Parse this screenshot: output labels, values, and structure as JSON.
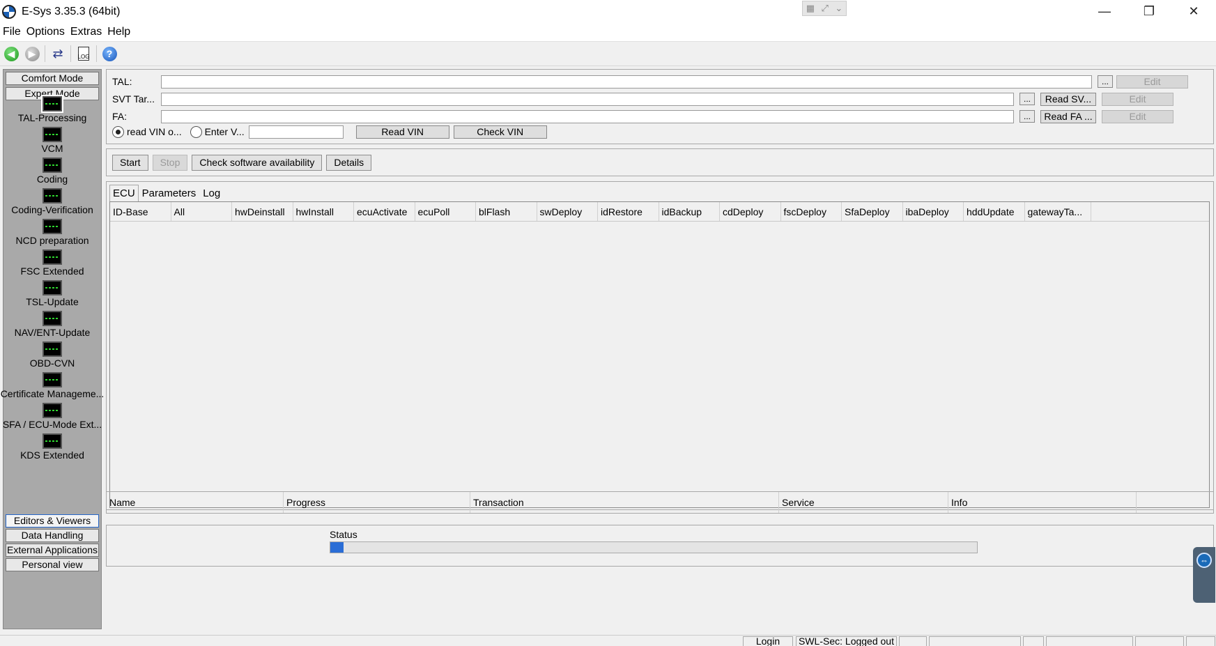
{
  "window": {
    "title": "E-Sys 3.35.3  (64bit)",
    "minimize_glyph": "—",
    "maximize_glyph": "❐",
    "close_glyph": "✕",
    "snap_icons": [
      "grid-icon",
      "expand-icon",
      "chevron-down-icon"
    ]
  },
  "menu": [
    "File",
    "Options",
    "Extras",
    "Help"
  ],
  "toolbar": {
    "icons": [
      "back-icon",
      "forward-icon",
      "network-icon",
      "document-icon",
      "help-icon"
    ]
  },
  "sidebar": {
    "mode_buttons": [
      "Comfort Mode",
      "Expert Mode"
    ],
    "items": [
      "TAL-Processing",
      "VCM",
      "Coding",
      "Coding-Verification",
      "NCD preparation",
      "FSC Extended",
      "TSL-Update",
      "NAV/ENT-Update",
      "OBD-CVN",
      "Certificate Manageme...",
      "SFA / ECU-Mode Ext...",
      "KDS Extended"
    ],
    "bottom_buttons": [
      "Editors & Viewers",
      "Data Handling",
      "External Applications",
      "Personal view"
    ]
  },
  "top_panel": {
    "tal_label": "TAL:",
    "svt_label": "SVT Tar...",
    "fa_label": "FA:",
    "dots": "...",
    "edit_label": "Edit",
    "read_svt_label": "Read SV...",
    "read_fa_label": "Read FA ...",
    "radio_read_vin": "read VIN o...",
    "radio_enter_vin": "Enter V...",
    "read_vin_button": "Read VIN",
    "check_vin_button": "Check VIN"
  },
  "actions": {
    "start": "Start",
    "stop": "Stop",
    "check_sw": "Check software availability",
    "details": "Details"
  },
  "tabs": [
    "ECU",
    "Parameters",
    "Log"
  ],
  "ecu_table": {
    "columns": [
      "ID-Base",
      "All",
      "hwDeinstall",
      "hwInstall",
      "ecuActivate",
      "ecuPoll",
      "blFlash",
      "swDeploy",
      "idRestore",
      "idBackup",
      "cdDeploy",
      "fscDeploy",
      "SfaDeploy",
      "ibaDeploy",
      "hddUpdate",
      "gatewayTa..."
    ]
  },
  "transaction_table": {
    "columns": [
      "Name",
      "Progress",
      "Transaction",
      "Service",
      "Info"
    ]
  },
  "status": {
    "label": "Status",
    "progress": 0.002
  },
  "statusbar": {
    "login": "Login",
    "swl_sec": "SWL-Sec: Logged out"
  }
}
